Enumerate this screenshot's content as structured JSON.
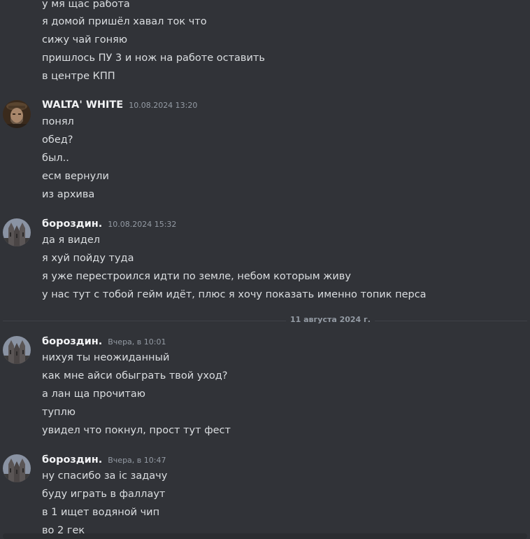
{
  "top_messages": [
    "у мя щас работа",
    "я домой пришёл хавал ток что",
    "сижу чай гоняю",
    "пришлось ПУ 3 и нож на работе оставить",
    "в центре КПП"
  ],
  "groups": [
    {
      "username": "WALTA' WHITE",
      "timestamp": "10.08.2024 13:20",
      "avatar": "bearded-man-avatar",
      "messages": [
        "понял",
        "обед?",
        "был..",
        "есм вернули",
        "из архива"
      ]
    },
    {
      "username": "бороздин.",
      "timestamp": "10.08.2024 15:32",
      "avatar": "cathedral-avatar",
      "messages": [
        "да я видел",
        "я хуй пойду туда",
        "я уже перестроился идти по земле, небом которым живу",
        "у нас тут с тобой гейм идёт, плюс я хочу показать именно топик перса"
      ]
    },
    {
      "username": "бороздин.",
      "timestamp": "Вчера, в 10:01",
      "avatar": "cathedral-avatar",
      "messages": [
        "нихуя ты неожиданный",
        "как мне айси обыграть твой уход?",
        "а лан ща прочитаю",
        "туплю",
        "увидел что покнул, прост тут фест"
      ]
    },
    {
      "username": "бороздин.",
      "timestamp": "Вчера, в 10:47",
      "avatar": "cathedral-avatar",
      "messages": [
        "ну спасибо за іс задачу",
        "буду играть в фаллаут",
        "в 1 ищет водяной чип",
        "во 2 гек"
      ]
    }
  ],
  "date_divider": "11 августа 2024 г.",
  "colors": {
    "background": "#313338",
    "text": "#dbdee1",
    "username": "#f2f3f5",
    "muted": "#949ba4"
  }
}
